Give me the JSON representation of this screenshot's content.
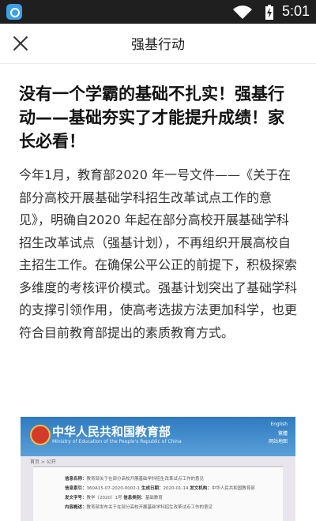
{
  "status_bar": {
    "time": "5:01",
    "app_icon": "app-icon",
    "wifi_icon": "wifi-icon",
    "battery_icon": "battery-charging-icon"
  },
  "header": {
    "title": "强基行动",
    "close_icon": "close-icon"
  },
  "article": {
    "headline": "没有一个学霸的基础不扎实！强基行动——基础夯实了才能提升成绩！家长必看！",
    "paragraph": "今年1月，教育部2020 年一号文件——《关于在部分高校开展基础学科招生改革试点工作的意见》，明确自2020 年起在部分高校开展基础学科招生改革试点（强基计划），不再组织开展高校自主招生工作。在确保公平公正的前提下，积极探索多维度的考核评价模式。强基计划突出了基础学科的支撑引领作用，使高考选拔方法更加科学，也更符合目前教育部提出的素质教育方式。"
  },
  "embedded_image": {
    "ministry_name_cn": "中华人民共和国教育部",
    "ministry_name_en": "Ministry of Education of the People's Republic of China",
    "top_links": [
      "English",
      "繁體",
      "网站地图"
    ],
    "breadcrumb": "首页 > 公开",
    "doc_rows": [
      {
        "label": "信息名称：",
        "value": "教育部关于在部分高校开展基础学科招生改革试点工作的意见"
      },
      {
        "label": "信息索引：",
        "value": "360A15-07-2020-0002-1",
        "label2": "生成日期：",
        "value2": "2020-01-14",
        "label3": "发文机构：",
        "value3": "中华人民共和国教育部"
      },
      {
        "label": "发文字号：",
        "value": "教学〔2020〕1号",
        "label2": "信息类别：",
        "value2": "基础教育"
      },
      {
        "label": "内容概述：",
        "value": "教育部发布关于在部分高校开展基础学科招生改革试点工作的意见"
      }
    ]
  }
}
